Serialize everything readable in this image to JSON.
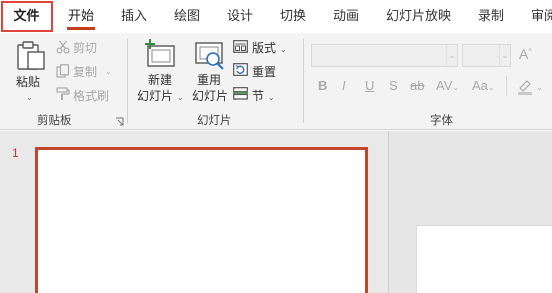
{
  "tabs": {
    "file": "文件",
    "home": "开始",
    "insert": "插入",
    "draw": "绘图",
    "design": "设计",
    "transitions": "切换",
    "animations": "动画",
    "slideshow": "幻灯片放映",
    "record": "录制",
    "review": "审阅"
  },
  "clipboard": {
    "paste": "粘贴",
    "cut": "剪切",
    "copy": "复制",
    "format_painter": "格式刷",
    "group_label": "剪贴板"
  },
  "slides": {
    "new_slide_line1": "新建",
    "new_slide_line2": "幻灯片",
    "reuse_line1": "重用",
    "reuse_line2": "幻灯片",
    "layout": "版式",
    "reset": "重置",
    "section": "节",
    "group_label": "幻灯片"
  },
  "font": {
    "bold": "B",
    "italic": "I",
    "underline": "U",
    "shadow": "S",
    "strikethrough": "ab",
    "spacing": "AV",
    "change_case": "Aa",
    "group_label": "字体"
  },
  "thumbnails": {
    "slide_number": "1"
  },
  "colors": {
    "accent": "#c43e1c",
    "highlight_box": "#e0443a",
    "ribbon_bg": "#f3f3f3"
  }
}
